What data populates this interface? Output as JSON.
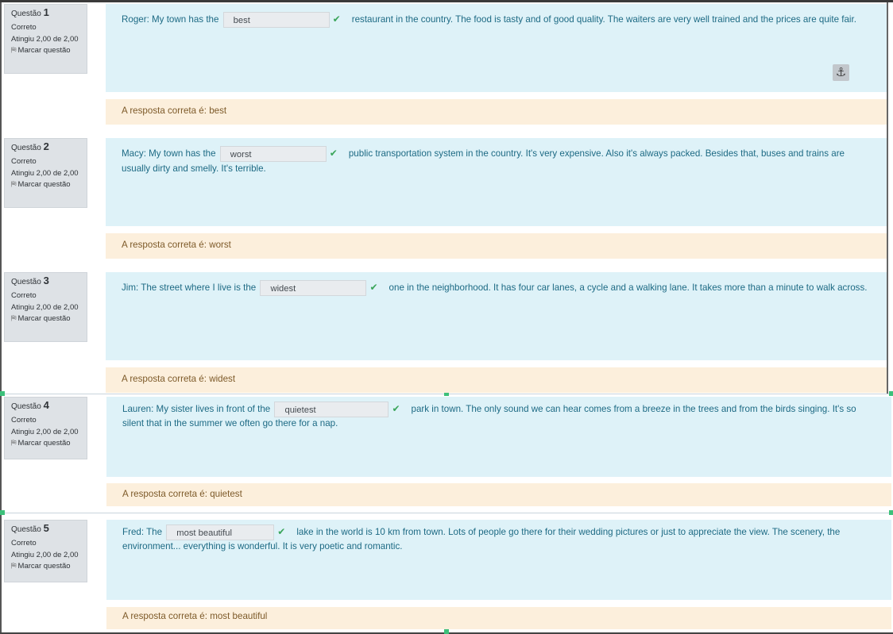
{
  "labels": {
    "question_prefix": "Questão",
    "state": "Correto",
    "grade": "Atingiu 2,00 de 2,00",
    "flag": "Marcar questão",
    "answer_prefix": "A resposta correta é: "
  },
  "questions": [
    {
      "number": "1",
      "before": "Roger: My town has the",
      "answer": "best",
      "after": "restaurant in the country. The food is tasty and of good quality. The waiters are very well trained and the prices are quite fair.",
      "correct": "best"
    },
    {
      "number": "2",
      "before": "Macy: My town has the",
      "answer": "worst",
      "after": "public transportation system in the country. It's very expensive. Also it's always packed. Besides that, buses and trains are usually dirty and smelly. It's terrible.",
      "correct": "worst"
    },
    {
      "number": "3",
      "before": "Jim: The street where I live is the",
      "answer": "widest",
      "after": "one in the neighborhood. It has four car lanes, a cycle and a walking lane. It takes more than a minute to walk across.",
      "correct": "widest"
    },
    {
      "number": "4",
      "before": "Lauren: My sister lives in front of the",
      "answer": "quietest",
      "after": "park in town. The only sound we can hear comes from a breeze in the trees and from the birds singing. It's so silent that in the summer we often go there for a nap.",
      "correct": "quietest"
    },
    {
      "number": "5",
      "before": "Fred: The",
      "answer": "most beautiful",
      "after": "lake in the world is 10 km from town. Lots of people go there for their wedding pictures or just to appreciate the view. The scenery, the environment... everything is wonderful. It is very poetic and romantic.",
      "correct": "most beautiful"
    }
  ],
  "icons": {
    "check": "check-icon",
    "flag": "flag-icon",
    "anchor": "anchor-icon"
  },
  "colors": {
    "question_bg": "#def2f8",
    "answer_bg": "#fcefdc",
    "info_bg": "#dee2e6",
    "check": "#3aa55a"
  }
}
